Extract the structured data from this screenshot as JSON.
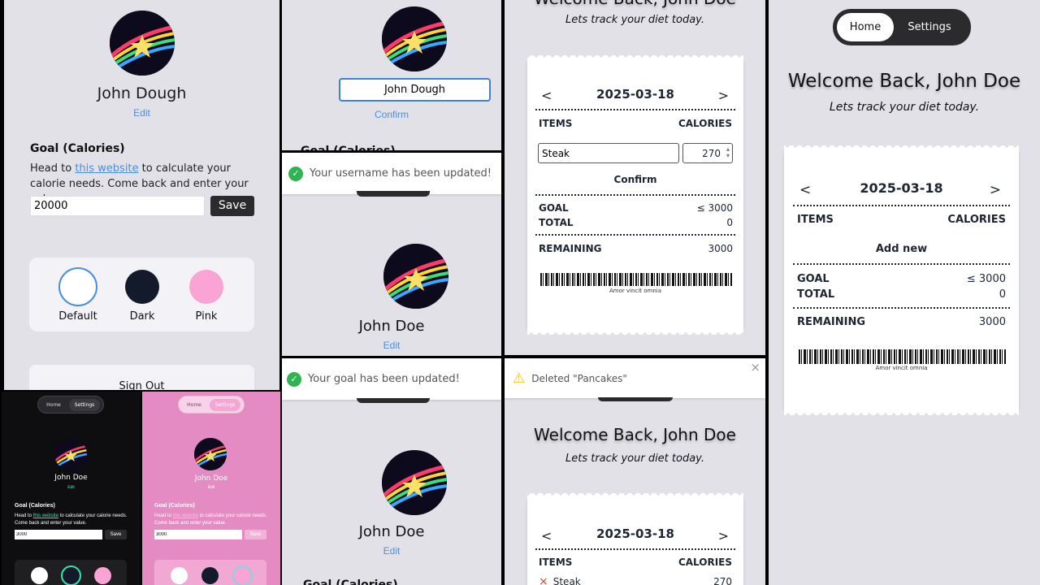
{
  "colors": {
    "bg": "#e2e1e8",
    "accent": "#4a8ee0",
    "dark_bg": "#0e0e10",
    "pink_bg": "#e58bc3",
    "success": "#2eb552",
    "warning": "#f2c318",
    "danger": "#e0443a"
  },
  "profile": {
    "name_original": "John Dough",
    "name_new": "John Doe",
    "edit_label": "Edit",
    "confirm_label": "Confirm",
    "input_value": "John Dough"
  },
  "goal": {
    "heading": "Goal (Calories)",
    "desc_before": "Head to ",
    "desc_link": "this website",
    "desc_after": " to calculate your calorie needs. Come back and enter your value.",
    "value_main": "20000",
    "value_small": "3000",
    "save_label": "Save"
  },
  "themes": [
    {
      "label": "Default",
      "color": "#ffffff"
    },
    {
      "label": "Dark",
      "color": "#131a2b"
    },
    {
      "label": "Pink",
      "color": "#f9a4d4"
    }
  ],
  "sign_out": "Sign Out",
  "toasts": {
    "username": "Your username has been updated!",
    "goal": "Your goal has been updated!",
    "deleted": "Deleted \"Pancakes\"",
    "close": "×"
  },
  "nav": {
    "home": "Home",
    "settings": "Settings"
  },
  "welcome": {
    "title": "Welcome Back, John Doe",
    "tagline": "Lets track your diet today."
  },
  "receipt": {
    "prev": "<",
    "next": ">",
    "date": "2025-03-18",
    "items_header": "ITEMS",
    "calories_header": "CALORIES",
    "item_name_input": "Steak",
    "item_cal_input": "270",
    "confirm": "Confirm",
    "add_new": "Add new",
    "goal_label": "GOAL",
    "goal_value": "≤ 3000",
    "total_label": "TOTAL",
    "total_value": "0",
    "remaining_label": "REMAINING",
    "remaining_value": "3000",
    "motto": "Amor vincit omnia",
    "list_item_name": "Steak",
    "list_item_cal": "270",
    "delete_icon": "×"
  }
}
